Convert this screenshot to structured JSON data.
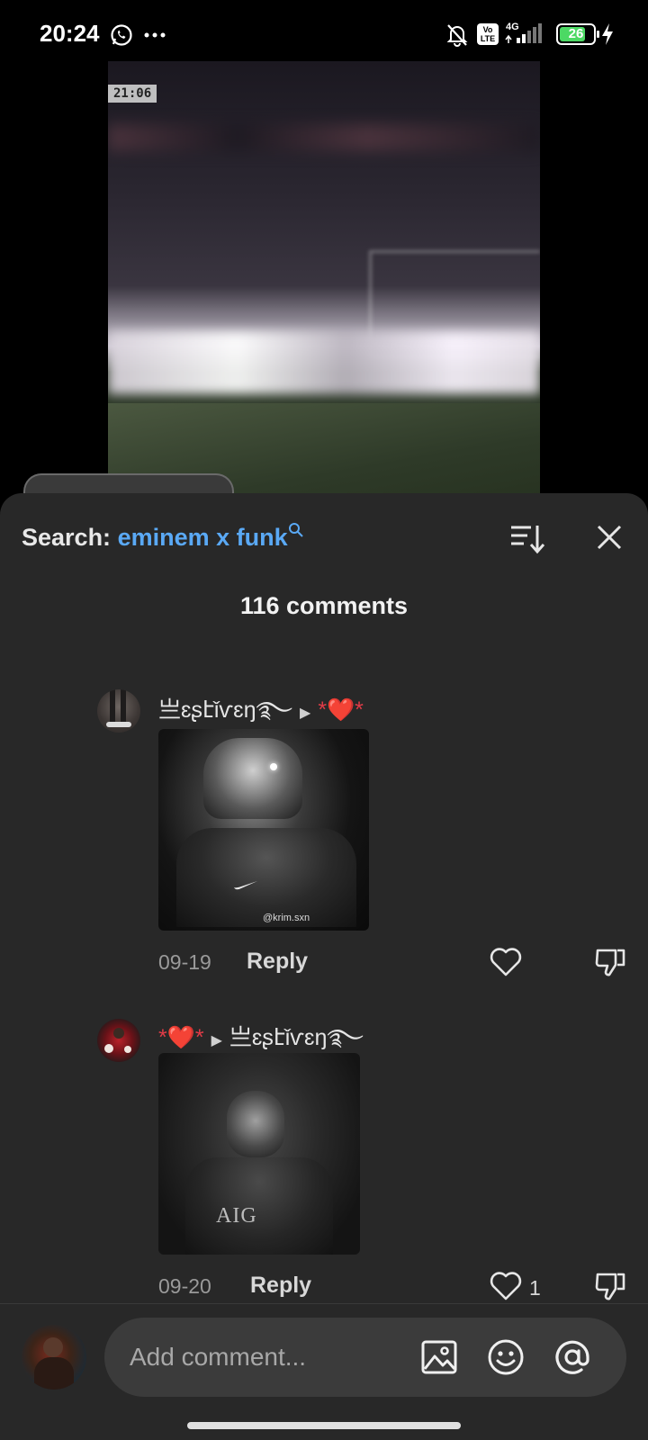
{
  "status_bar": {
    "time": "20:24",
    "battery": "26",
    "network": "4G",
    "volte_label": "Vo\nLTE",
    "icons": [
      "whatsapp-icon",
      "more-dots-icon",
      "bell-muted-icon",
      "volte-icon",
      "signal-icon",
      "battery-icon",
      "charging-icon"
    ]
  },
  "video": {
    "clock_overlay": "21:06"
  },
  "header": {
    "search_label": "Search:",
    "search_term": "eminem x funk",
    "comment_count": "116 comments"
  },
  "comments": [
    {
      "username": "亗ɛʂէǐѵɛŋ࿐",
      "reply_to": "*❤️*",
      "media_watermark": "@krim.sxn",
      "date": "09-19",
      "reply_label": "Reply",
      "likes": ""
    },
    {
      "username": "*❤️*",
      "reply_to": "亗ɛʂէǐѵɛŋ࿐",
      "media_text": "AIG",
      "date": "09-20",
      "reply_label": "Reply",
      "likes": "1"
    }
  ],
  "composer": {
    "placeholder": "Add comment..."
  },
  "colors": {
    "panel_bg": "#282828",
    "accent_blue": "#5aa9f5",
    "battery_green": "#4cd964"
  }
}
